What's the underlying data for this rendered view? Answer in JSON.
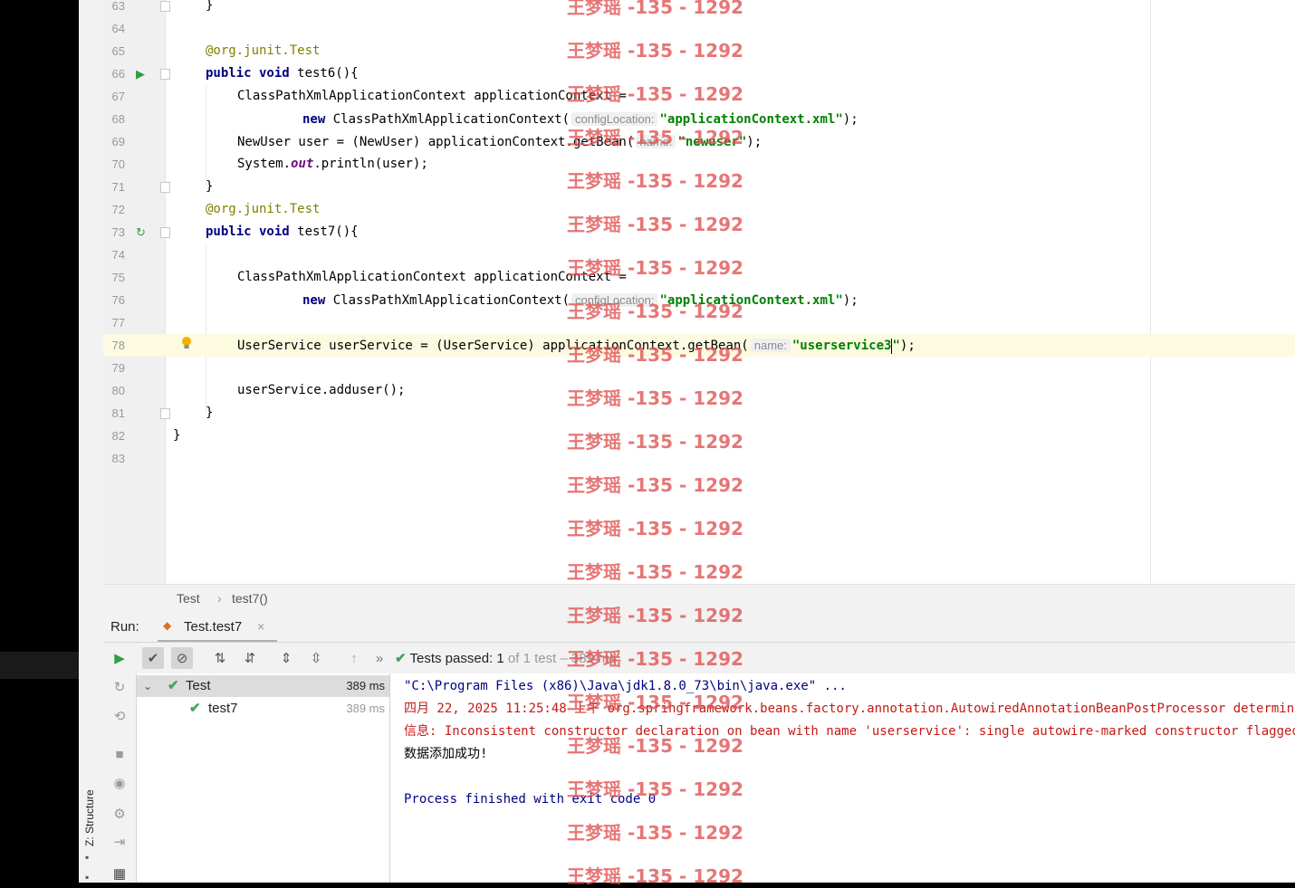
{
  "tool_window": {
    "structure_label": "Z: Structure"
  },
  "editor": {
    "lines": [
      {
        "n": "63"
      },
      {
        "n": "64"
      },
      {
        "n": "65"
      },
      {
        "n": "66"
      },
      {
        "n": "67"
      },
      {
        "n": "68"
      },
      {
        "n": "69"
      },
      {
        "n": "70"
      },
      {
        "n": "71"
      },
      {
        "n": "72"
      },
      {
        "n": "73"
      },
      {
        "n": "74"
      },
      {
        "n": "75"
      },
      {
        "n": "76"
      },
      {
        "n": "77"
      },
      {
        "n": "78"
      },
      {
        "n": "79"
      },
      {
        "n": "80"
      },
      {
        "n": "81"
      },
      {
        "n": "82"
      },
      {
        "n": "83"
      }
    ],
    "code": {
      "l63": "}",
      "l65_at": "@org.junit.",
      "l65_ann": "Test",
      "l66_kw": "public void",
      "l66_rest": " test6(){",
      "l67": "ClassPathXmlApplicationContext applicationContext =",
      "l68_kw": "new",
      "l68_rest": " ClassPathXmlApplicationContext(",
      "l68_hint": "configLocation:",
      "l68_str": "\"applicationContext.xml\"",
      "l68_end": ");",
      "l69_pre": "NewUser user = (NewUser) applicationContext.getBean(",
      "l69_hint": "name:",
      "l69_str": "\"newuser\"",
      "l69_end": ");",
      "l70_pre": "System.",
      "l70_fld": "out",
      "l70_end": ".println(user);",
      "l71": "}",
      "l72_at": "@org.junit.",
      "l72_ann": "Test",
      "l73_kw": "public void",
      "l73_rest": " test7(){",
      "l75": "ClassPathXmlApplicationContext applicationContext =",
      "l76_kw": "new",
      "l76_rest": " ClassPathXmlApplicationContext(",
      "l76_hint": "configLocation:",
      "l76_str": "\"applicationContext.xml\"",
      "l76_end": ");",
      "l78_pre": "UserService userService = (UserService) applicationContext.getBean(",
      "l78_hint": "name:",
      "l78_str": "\"userservice3",
      "l78_str_end": "\"",
      "l78_end": ");",
      "l80": "userService.adduser();",
      "l81": "}",
      "l82": "}"
    }
  },
  "breadcrumb": {
    "class": "Test",
    "method": "test7()"
  },
  "run": {
    "label": "Run:",
    "tab": "Test.test7",
    "status_passed": "Tests passed:",
    "status_count": "1",
    "status_of": "of 1 test",
    "status_time": "389 ms"
  },
  "tree": [
    {
      "label": "Test",
      "time": "389 ms"
    },
    {
      "label": "test7",
      "time": "389 ms"
    }
  ],
  "console": {
    "line1": "\"C:\\Program Files (x86)\\Java\\jdk1.8.0_73\\bin\\java.exe\" ...",
    "line2": "四月 22, 2025 11:25:48 上午 org.springframework.beans.factory.annotation.AutowiredAnnotationBeanPostProcessor determineCandidateConstructors",
    "line3": "信息: Inconsistent constructor declaration on bean with name 'userservice': single autowire-marked constructor flagged as optional",
    "line4": "数据添加成功!",
    "line5": "Process finished with exit code 0"
  },
  "watermark": {
    "text": "王梦瑶 -135 - 1292"
  },
  "colors": {
    "current_line": "#fcfae1",
    "keyword": "#000080",
    "string": "#008000",
    "annotation": "#808000",
    "watermark": "#e05050"
  }
}
